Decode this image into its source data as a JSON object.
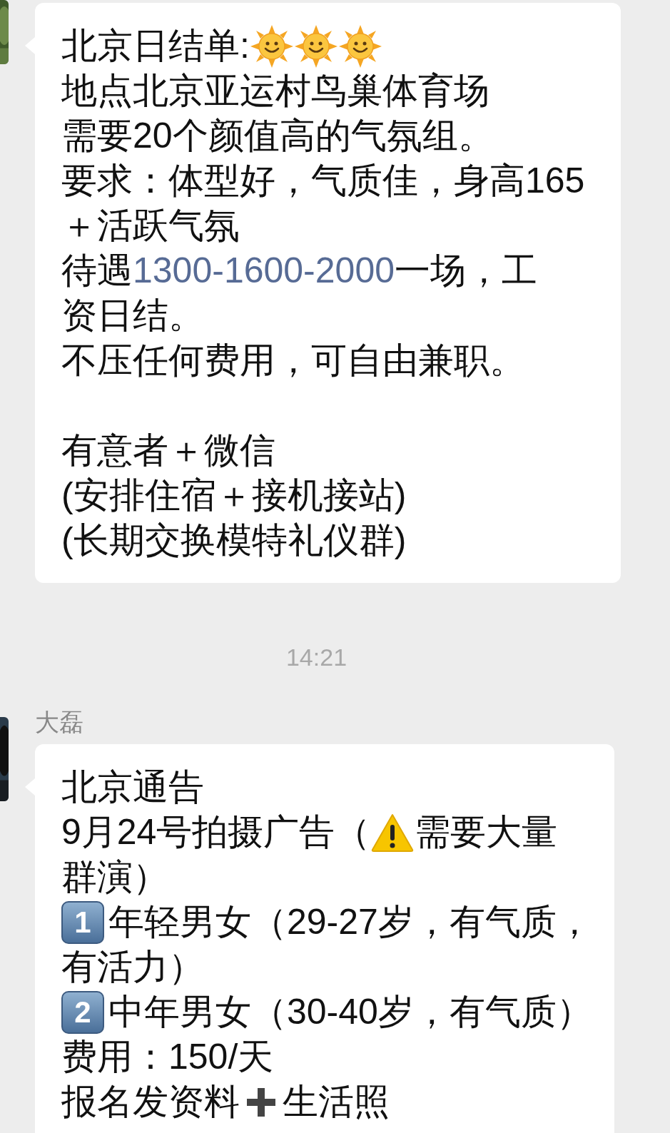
{
  "messages": [
    {
      "paragraphs": [
        [
          [
            {
              "kind": "text",
              "text": "北京日结单:"
            },
            {
              "kind": "sun"
            },
            {
              "kind": "sun"
            },
            {
              "kind": "sun"
            }
          ],
          [
            {
              "kind": "text",
              "text": "地点北京亚运村鸟巢体育场"
            }
          ],
          [
            {
              "kind": "text",
              "text": "需要20个颜值高的气氛组。"
            }
          ],
          [
            {
              "kind": "text",
              "text": "要求：体型好，气质佳，身高165"
            }
          ],
          [
            {
              "kind": "text",
              "text": "＋活跃气氛"
            }
          ],
          [
            {
              "kind": "text",
              "text": "待遇"
            },
            {
              "kind": "link",
              "text": "1300-1600-2000"
            },
            {
              "kind": "text",
              "text": "一场，工"
            }
          ],
          [
            {
              "kind": "text",
              "text": "资日结。"
            }
          ],
          [
            {
              "kind": "text",
              "text": "不压任何费用，可自由兼职。"
            }
          ]
        ],
        [
          [
            {
              "kind": "text",
              "text": "有意者＋微信"
            }
          ],
          [
            {
              "kind": "text",
              "text": "(安排住宿＋接机接站)"
            }
          ],
          [
            {
              "kind": "text",
              "text": "(长期交换模特礼仪群)"
            }
          ]
        ]
      ]
    },
    {
      "timestamp": "14:21"
    },
    {
      "sender": "大磊",
      "paragraphs": [
        [
          [
            {
              "kind": "text",
              "text": "北京通告"
            }
          ],
          [
            {
              "kind": "text",
              "text": "9月24号拍摄广告（"
            },
            {
              "kind": "warning"
            },
            {
              "kind": "text",
              "text": "需要大量"
            }
          ],
          [
            {
              "kind": "text",
              "text": "群演）"
            }
          ],
          [
            {
              "kind": "keycap",
              "text": "1"
            },
            {
              "kind": "text",
              "text": "年轻男女（29-27岁，有气质，"
            }
          ],
          [
            {
              "kind": "text",
              "text": "有活力）"
            }
          ],
          [
            {
              "kind": "keycap",
              "text": "2"
            },
            {
              "kind": "text",
              "text": "中年男女（30-40岁，有气质）"
            }
          ],
          [
            {
              "kind": "text",
              "text": "费用：150/天"
            }
          ],
          [
            {
              "kind": "text",
              "text": "报名发资料"
            },
            {
              "kind": "plus"
            },
            {
              "kind": "text",
              "text": "生活照"
            }
          ]
        ]
      ]
    }
  ]
}
